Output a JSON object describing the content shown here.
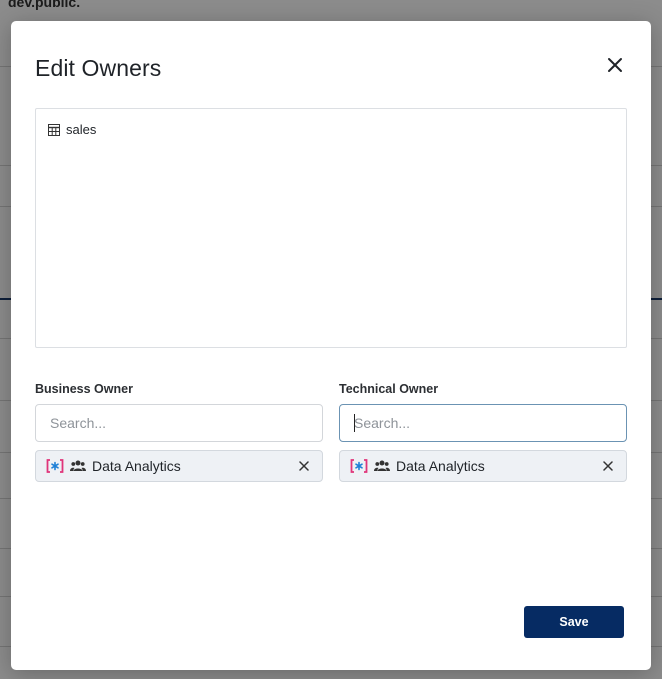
{
  "background": {
    "breadcrumb": "dev.public."
  },
  "modal": {
    "title": "Edit Owners",
    "assets": [
      {
        "name": "sales",
        "icon": "table-icon"
      }
    ],
    "business_owner": {
      "label": "Business Owner",
      "placeholder": "Search...",
      "selected": [
        {
          "name": "Data Analytics",
          "source_icon": "datahub-bracket-icon",
          "type_icon": "group-icon"
        }
      ]
    },
    "technical_owner": {
      "label": "Technical Owner",
      "placeholder": "Search...",
      "selected": [
        {
          "name": "Data Analytics",
          "source_icon": "datahub-bracket-icon",
          "type_icon": "group-icon"
        }
      ]
    },
    "save_label": "Save"
  },
  "colors": {
    "primary": "#062b63",
    "chip_bg": "#eef1f5",
    "brand_blue": "#1d7fd6",
    "brand_pink": "#e0357a"
  }
}
